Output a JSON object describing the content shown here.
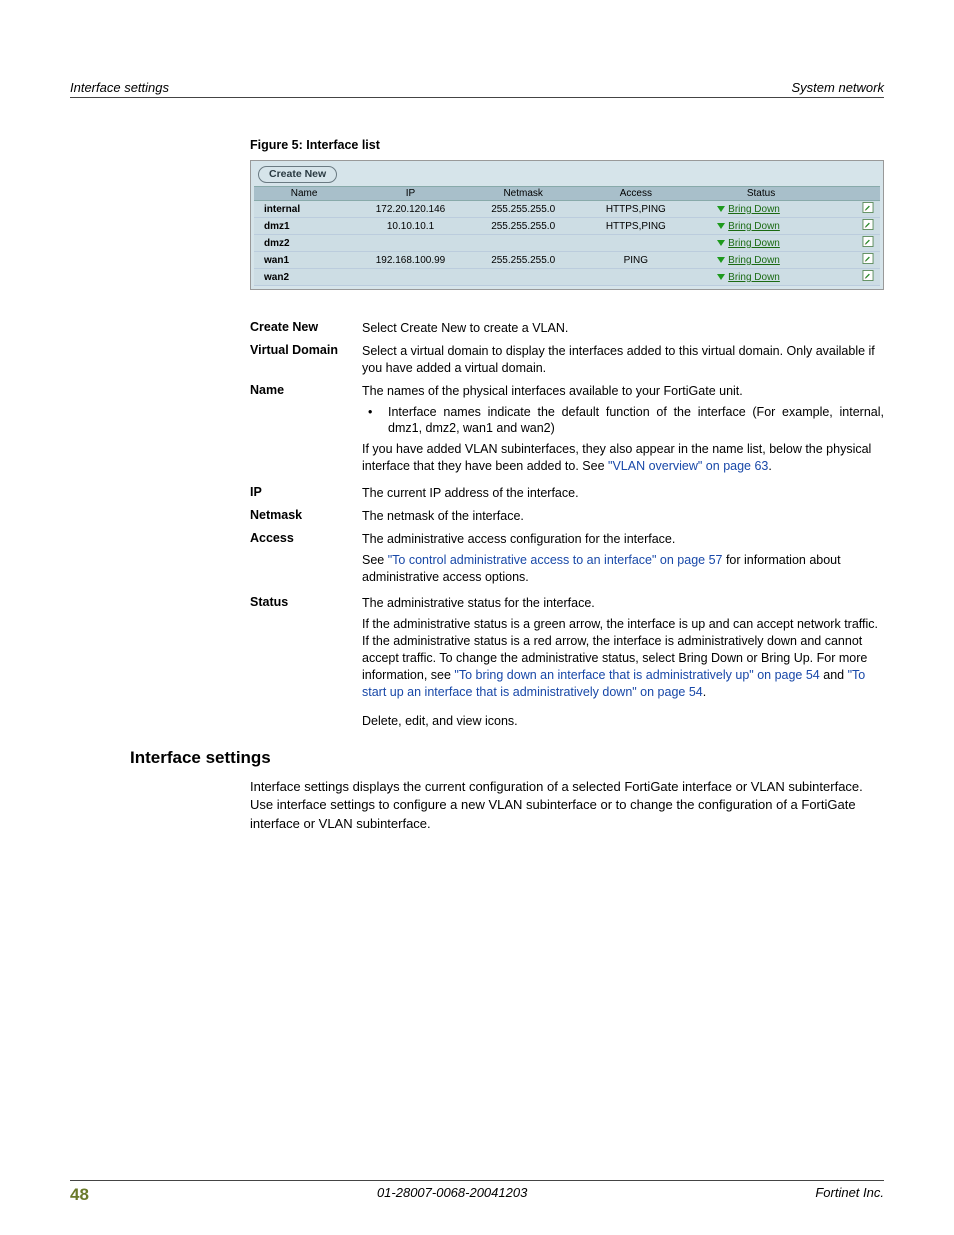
{
  "header": {
    "left": "Interface settings",
    "right": "System network"
  },
  "figure": {
    "caption": "Figure 5:   Interface list",
    "create_btn": "Create New",
    "columns": {
      "name": "Name",
      "ip": "IP",
      "netmask": "Netmask",
      "access": "Access",
      "status": "Status"
    },
    "rows": [
      {
        "name": "internal",
        "ip": "172.20.120.146",
        "netmask": "255.255.255.0",
        "access": "HTTPS,PING",
        "status": "Bring Down"
      },
      {
        "name": "dmz1",
        "ip": "10.10.10.1",
        "netmask": "255.255.255.0",
        "access": "HTTPS,PING",
        "status": "Bring Down"
      },
      {
        "name": "dmz2",
        "ip": "",
        "netmask": "",
        "access": "",
        "status": "Bring Down"
      },
      {
        "name": "wan1",
        "ip": "192.168.100.99",
        "netmask": "255.255.255.0",
        "access": "PING",
        "status": "Bring Down"
      },
      {
        "name": "wan2",
        "ip": "",
        "netmask": "",
        "access": "",
        "status": "Bring Down"
      }
    ]
  },
  "defs": {
    "create_new": {
      "term": "Create New",
      "body": "Select Create New to create a VLAN."
    },
    "virtual_domain": {
      "term": "Virtual Domain",
      "body": "Select a virtual domain to display the interfaces added to this virtual domain. Only available if you have added a virtual domain."
    },
    "name": {
      "term": "Name",
      "p1": "The names of the physical interfaces available to your FortiGate unit.",
      "bullet": "Interface names indicate the default function of the interface (For example, internal, dmz1, dmz2, wan1 and wan2)",
      "p2_pre": "If you have added VLAN subinterfaces, they also appear in the name list, below the physical interface that they have been added to. See ",
      "p2_link": "\"VLAN overview\" on page 63",
      "p2_post": "."
    },
    "ip": {
      "term": "IP",
      "body": "The current IP address of the interface."
    },
    "netmask": {
      "term": "Netmask",
      "body": "The netmask of the interface."
    },
    "access": {
      "term": "Access",
      "p1": "The administrative access configuration for the interface.",
      "p2_pre": "See ",
      "p2_link": "\"To control administrative access to an interface\" on page 57",
      "p2_post": " for information about administrative access options."
    },
    "status": {
      "term": "Status",
      "p1": "The administrative status for the interface.",
      "p2_pre": "If the administrative status is a green arrow, the interface is up and can accept network traffic. If the administrative status is a red arrow, the interface is administratively down and cannot accept traffic. To change the administrative status, select Bring Down or Bring Up. For more information, see ",
      "p2_link1": "\"To bring down an interface that is administratively up\" on page 54",
      "p2_mid": " and ",
      "p2_link2": "\"To start up an interface that is administratively down\" on page 54",
      "p2_post": "."
    },
    "icons": {
      "body": "Delete, edit, and view icons."
    }
  },
  "section": {
    "heading": "Interface settings",
    "body": "Interface settings displays the current configuration of a selected FortiGate interface or VLAN subinterface. Use interface settings to configure a new VLAN subinterface or to change the configuration of a FortiGate interface or VLAN subinterface."
  },
  "footer": {
    "page": "48",
    "doc_id": "01-28007-0068-20041203",
    "company": "Fortinet Inc."
  }
}
